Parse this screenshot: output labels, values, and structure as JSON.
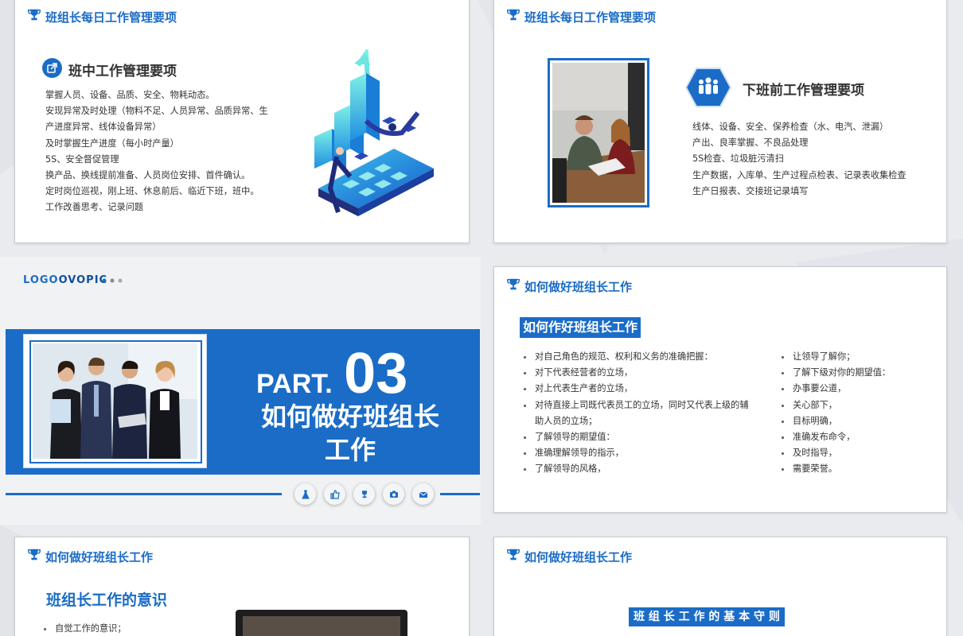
{
  "colors": {
    "brand": "#1b6cc6",
    "dark_blue": "#0d4f9c",
    "text": "#333333"
  },
  "slide1": {
    "header": "班组长每日工作管理要项",
    "section_icon": "external-link-icon",
    "section_title": "班中工作管理要项",
    "lines": [
      "掌握人员、设备、品质、安全、物耗动态。",
      "安现异常及时处理（物料不足、人员异常、品质异常、生",
      "产进度异常、线体设备异常）",
      "及时掌握生产进度（每小时产量）",
      "5S、安全督促管理",
      "换产品、换线提前准备、人员岗位安排、首件确认。",
      "定时岗位巡视，刚上班、休息前后、临近下班，班中。",
      "工作改善思考、记录问题"
    ]
  },
  "slide2": {
    "header": "班组长每日工作管理要项",
    "section_icon": "team-icon",
    "section_title": "下班前工作管理要项",
    "lines": [
      "线体、设备、安全、保养检查（水、电汽、泄漏）",
      "产出、良率掌握、不良品处理",
      "5S检查、垃圾脏污清扫",
      "生产数据，入库单、生产过程点检表、记录表收集检查",
      "生产日报表、交接班记录填写"
    ]
  },
  "slide3": {
    "logo_word": "LOGO",
    "logo_brand": "OVOPIC",
    "part_label": "PART.",
    "part_number": "03",
    "title_line1": "如何做好班组长",
    "title_line2": "工作",
    "icons": [
      "flask-icon",
      "thumbs-up-icon",
      "trophy-icon",
      "camera-icon",
      "mail-icon"
    ]
  },
  "slide4": {
    "header": "如何做好班组长工作",
    "banner": "如何作好班组长工作",
    "left_items": [
      "对自己角色的规范、权利和义务的准确把握：",
      "对下代表经营者的立场，",
      "对上代表生产者的立场，",
      "对待直接上司既代表员工的立场，同时又代表上级的辅",
      "助人员的立场；",
      "了解领导的期望值：",
      "准确理解领导的指示，",
      "了解领导的风格，"
    ],
    "right_items": [
      "让领导了解你；",
      "了解下级对你的期望值：",
      "办事要公道，",
      "关心部下，",
      "目标明确，",
      "准确发布命令，",
      "及时指导，",
      "需要荣誉。"
    ]
  },
  "slide5": {
    "header": "如何做好班组长工作",
    "title": "班组长工作的意识",
    "items": [
      "自觉工作的意识；"
    ]
  },
  "slide6": {
    "header": "如何做好班组长工作",
    "banner": "班 组 长 工 作 的 基 本 守 则"
  }
}
